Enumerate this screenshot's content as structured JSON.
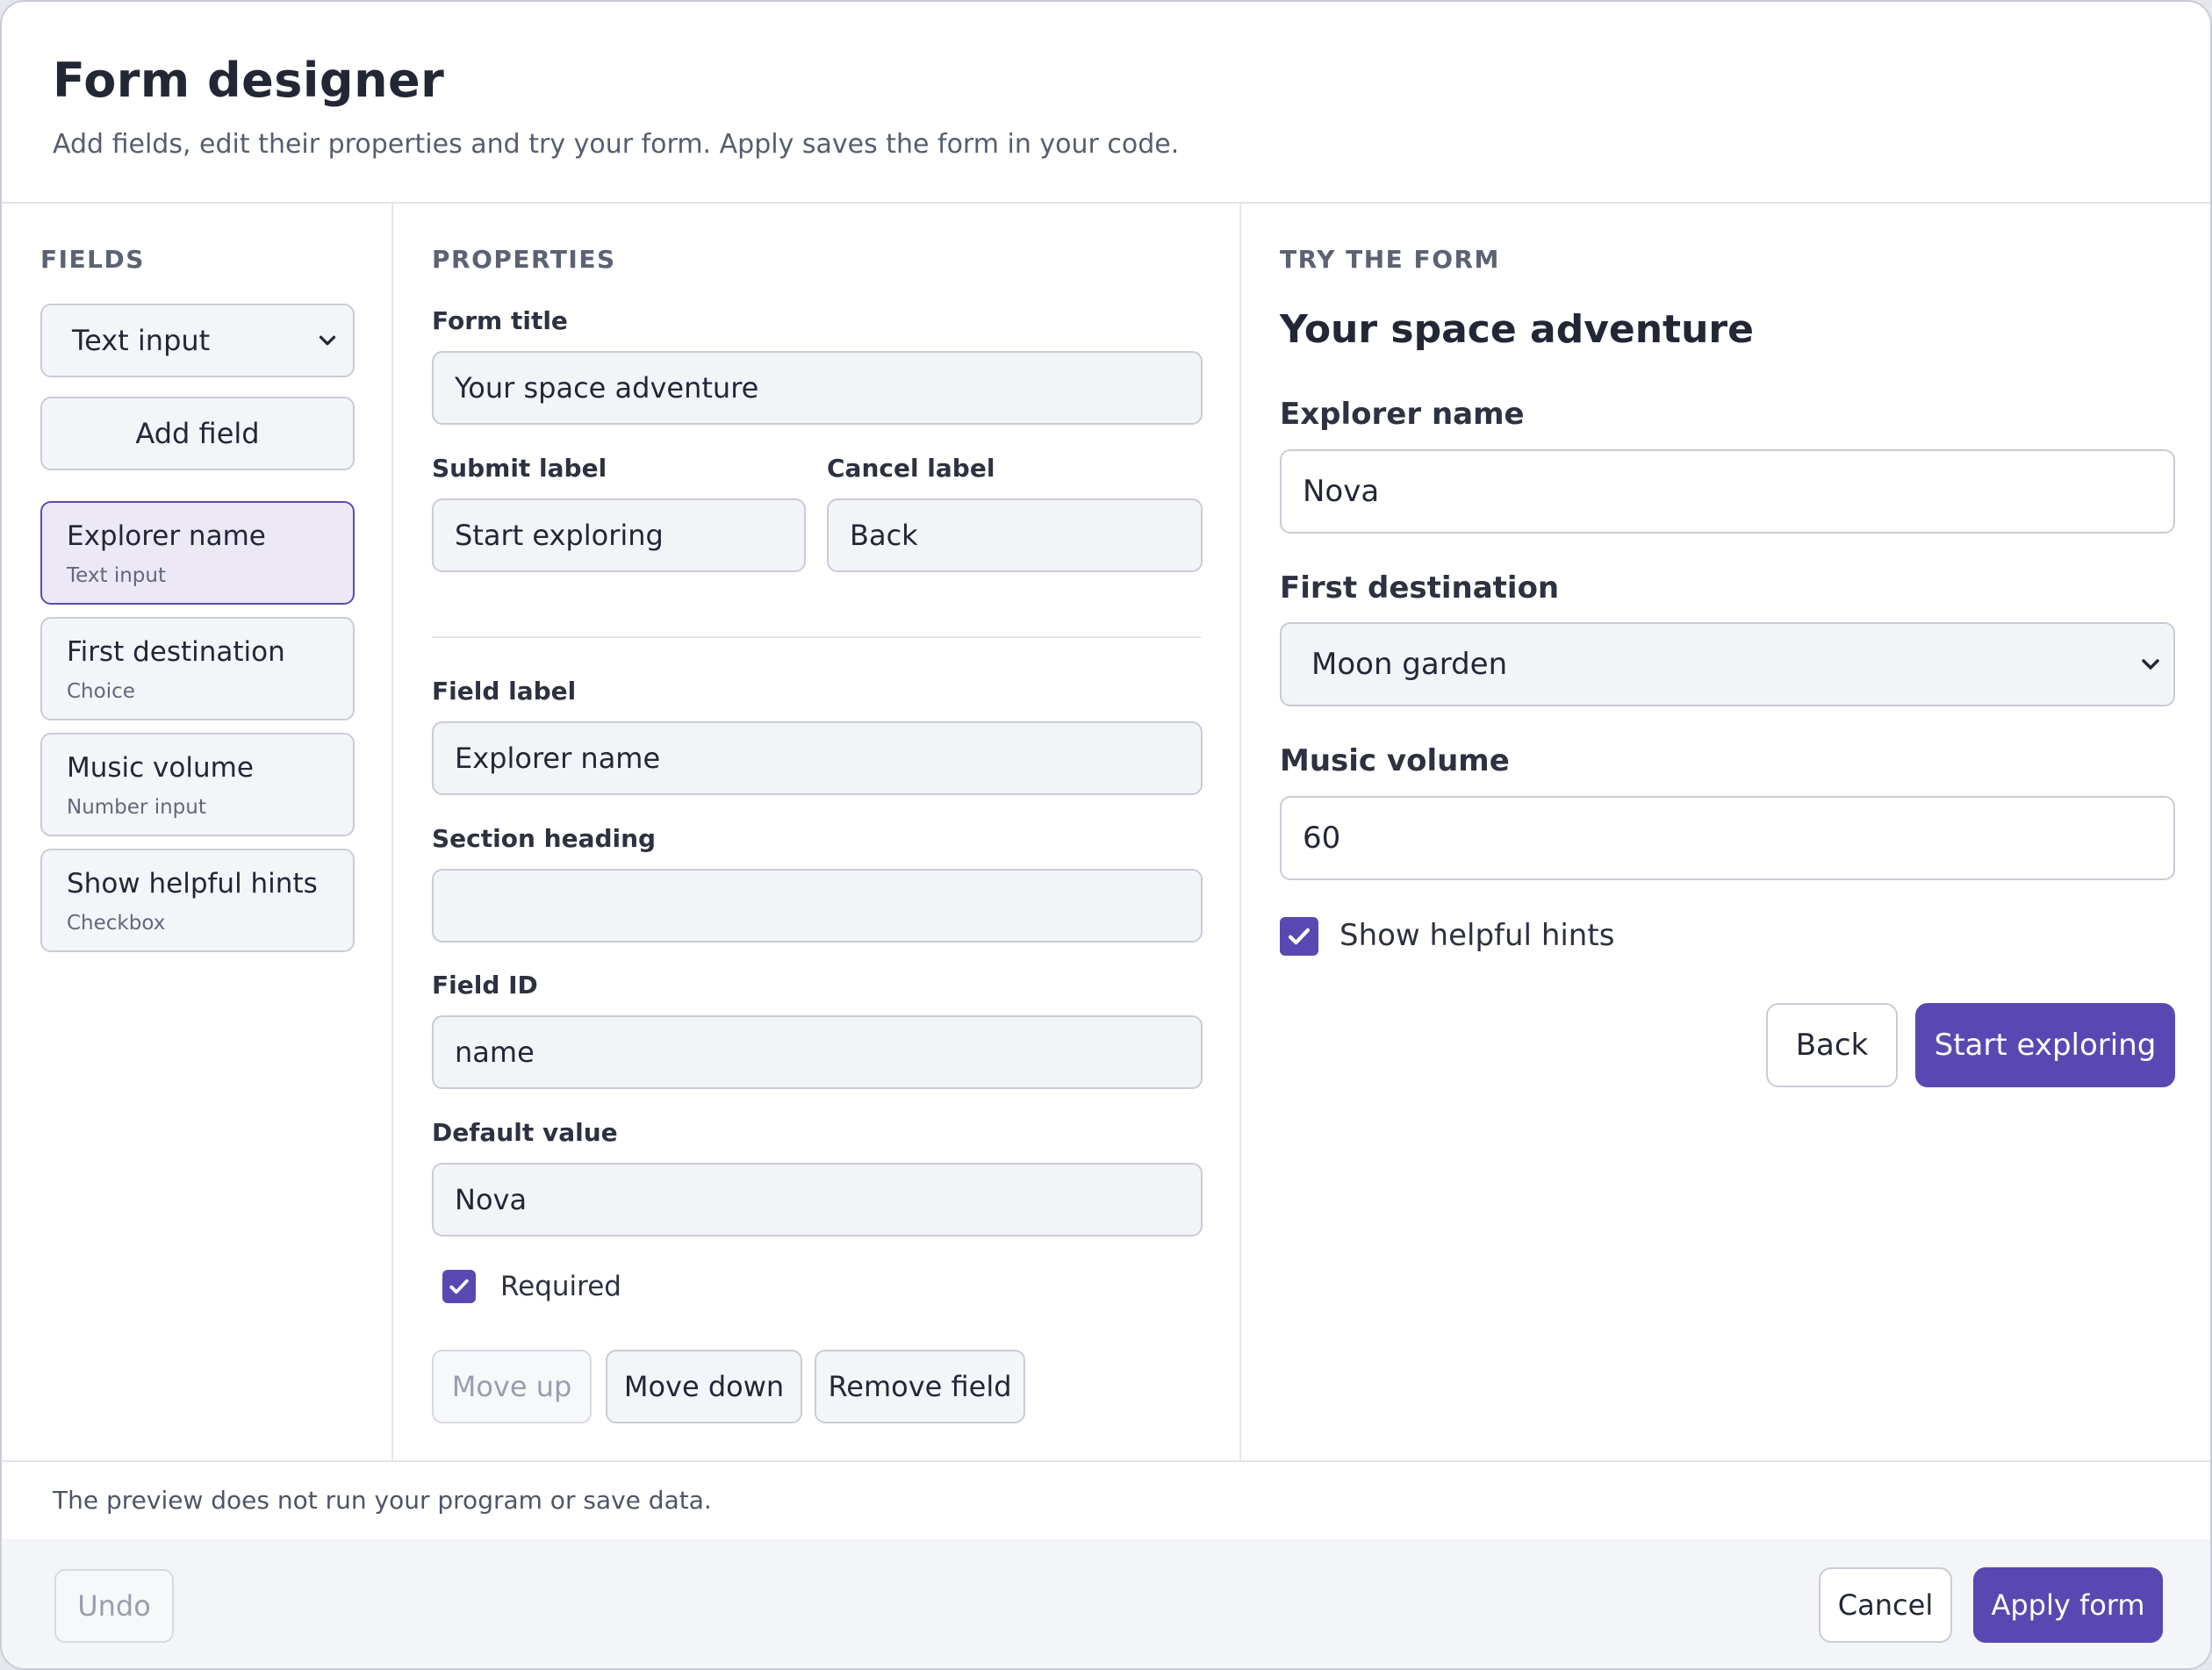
{
  "header": {
    "title": "Form designer",
    "subtitle": "Add fields, edit their properties and try your form. Apply saves the form in your code."
  },
  "fields_panel": {
    "title": "Fields",
    "type_select": "Text input",
    "add_button": "Add field",
    "items": [
      {
        "name": "Explorer name",
        "type": "Text input",
        "selected": true
      },
      {
        "name": "First destination",
        "type": "Choice",
        "selected": false
      },
      {
        "name": "Music volume",
        "type": "Number input",
        "selected": false
      },
      {
        "name": "Show helpful hints",
        "type": "Checkbox",
        "selected": false
      }
    ]
  },
  "properties": {
    "title": "Properties",
    "form_title_label": "Form title",
    "form_title_value": "Your space adventure",
    "submit_label": "Submit label",
    "submit_value": "Start exploring",
    "cancel_label": "Cancel label",
    "cancel_value": "Back",
    "field_label": "Field label",
    "field_label_value": "Explorer name",
    "section_heading": "Section heading",
    "section_heading_value": "",
    "field_id": "Field ID",
    "field_id_value": "name",
    "default_value": "Default value",
    "default_value_value": "Nova",
    "required_label": "Required",
    "required_checked": true,
    "move_up": "Move up",
    "move_down": "Move down",
    "remove_field": "Remove field"
  },
  "try_form": {
    "title": "Try the form",
    "form_title": "Your space adventure",
    "name_label": "Explorer name",
    "name_value": "Nova",
    "destination_label": "First destination",
    "destination_value": "Moon garden",
    "volume_label": "Music volume",
    "volume_value": "60",
    "hints_label": "Show helpful hints",
    "hints_checked": true,
    "back_button": "Back",
    "submit_button": "Start exploring"
  },
  "footer": {
    "note": "The preview does not run your program or save data.",
    "undo": "Undo",
    "cancel": "Cancel",
    "apply": "Apply form"
  },
  "colors": {
    "accent": "#5a48b2",
    "selected_bg": "#ece8f6",
    "border": "#c9ccd6"
  },
  "icons": {
    "dropdown": "chevron-down-icon",
    "check": "check-icon"
  }
}
